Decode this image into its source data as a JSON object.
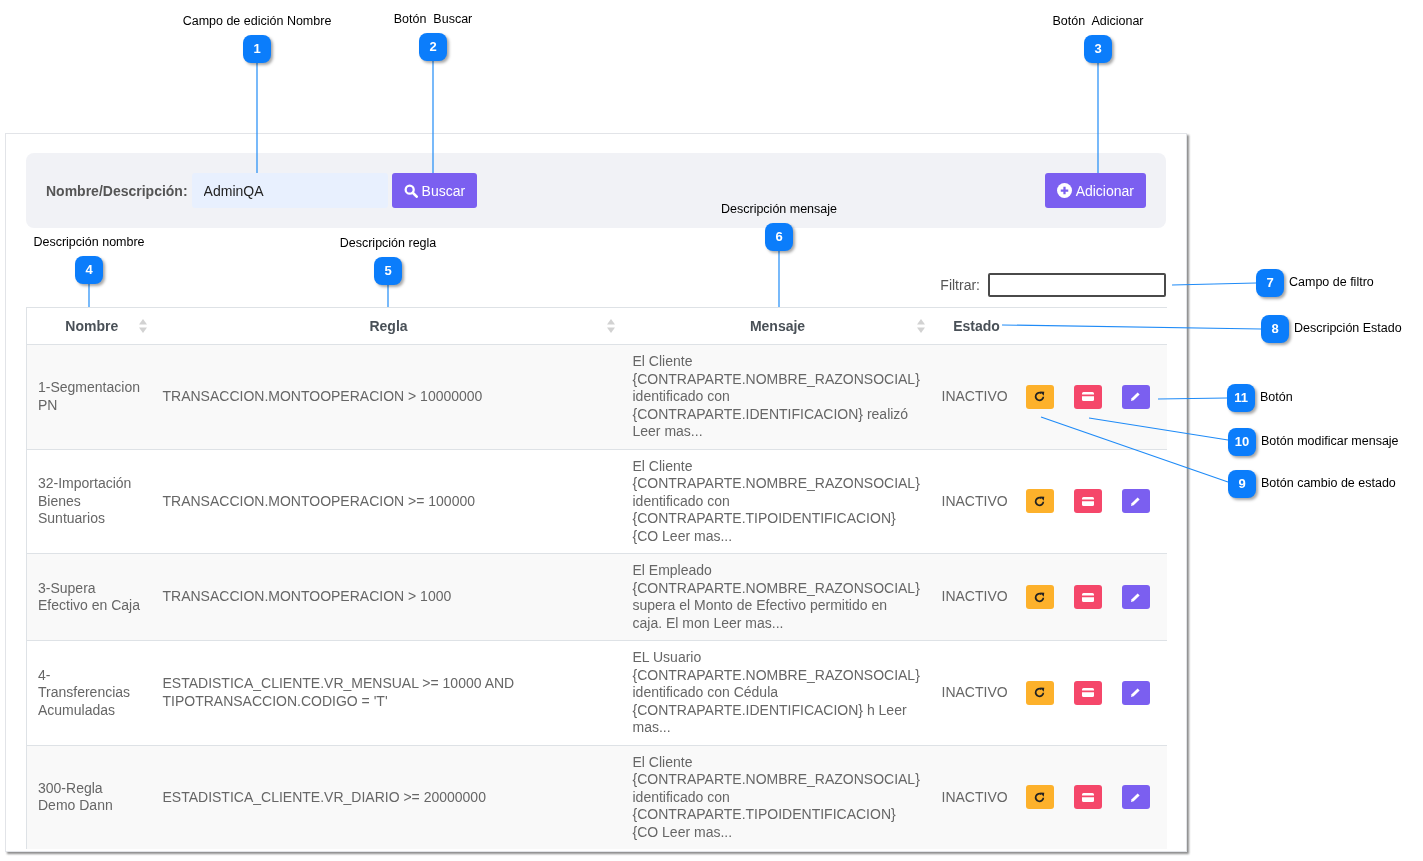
{
  "callouts": [
    {
      "number": "1",
      "label": "Campo de edición Nombre"
    },
    {
      "number": "2",
      "label": "Botón  Buscar"
    },
    {
      "number": "3",
      "label": "Botón  Adicionar"
    },
    {
      "number": "6",
      "label": "Descripción mensaje"
    },
    {
      "number": "4",
      "label": "Descripción nombre"
    },
    {
      "number": "5",
      "label": "Descripción regla"
    },
    {
      "number": "7",
      "label": "Campo de filtro"
    },
    {
      "number": "8",
      "label": "Descripción Estado"
    },
    {
      "number": "11",
      "label": "Botón"
    },
    {
      "number": "10",
      "label": "Botón modificar mensaje"
    },
    {
      "number": "9",
      "label": "Botón cambio de estado"
    }
  ],
  "search_bar": {
    "label": "Nombre/Descripción:",
    "name_field": {
      "value": "AdminQA"
    },
    "search_button": "Buscar",
    "add_button": "Adicionar"
  },
  "filter": {
    "label": "Filtrar:"
  },
  "table": {
    "columns": [
      {
        "label": "Nombre",
        "sortable": true
      },
      {
        "label": "Regla",
        "sortable": true
      },
      {
        "label": "Mensaje",
        "sortable": true
      },
      {
        "label": "Estado",
        "sortable": false
      }
    ],
    "rows": [
      {
        "nombre": "1-Segmentacion PN",
        "regla": "TRANSACCION.MONTOOPERACION > 10000000",
        "mensaje": "El Cliente {CONTRAPARTE.NOMBRE_RAZONSOCIAL} identificado con {CONTRAPARTE.IDENTIFICACION} realizó Leer mas...",
        "estado": "INACTIVO"
      },
      {
        "nombre": "32-Importación Bienes Suntuarios",
        "regla": "TRANSACCION.MONTOOPERACION >= 100000",
        "mensaje": "El Cliente {CONTRAPARTE.NOMBRE_RAZONSOCIAL} identificado con {CONTRAPARTE.TIPOIDENTIFICACION} {CO Leer mas...",
        "estado": "INACTIVO"
      },
      {
        "nombre": "3-Supera Efectivo en Caja",
        "regla": "TRANSACCION.MONTOOPERACION > 1000",
        "mensaje": "El Empleado {CONTRAPARTE.NOMBRE_RAZONSOCIAL} supera el Monto de Efectivo permitido en caja. El mon Leer mas...",
        "estado": "INACTIVO"
      },
      {
        "nombre": "4-Transferencias Acumuladas",
        "regla": "ESTADISTICA_CLIENTE.VR_MENSUAL >= 10000 AND TIPOTRANSACCION.CODIGO = 'T'",
        "mensaje": "EL Usuario {CONTRAPARTE.NOMBRE_RAZONSOCIAL} identificado con Cédula {CONTRAPARTE.IDENTIFICACION} h Leer mas...",
        "estado": "INACTIVO"
      },
      {
        "nombre": "300-Regla Demo Dann",
        "regla": "ESTADISTICA_CLIENTE.VR_DIARIO >= 20000000",
        "mensaje": "El Cliente {CONTRAPARTE.NOMBRE_RAZONSOCIAL} identificado con {CONTRAPARTE.TIPOIDENTIFICACION} {CO Leer mas...",
        "estado": "INACTIVO"
      }
    ]
  }
}
